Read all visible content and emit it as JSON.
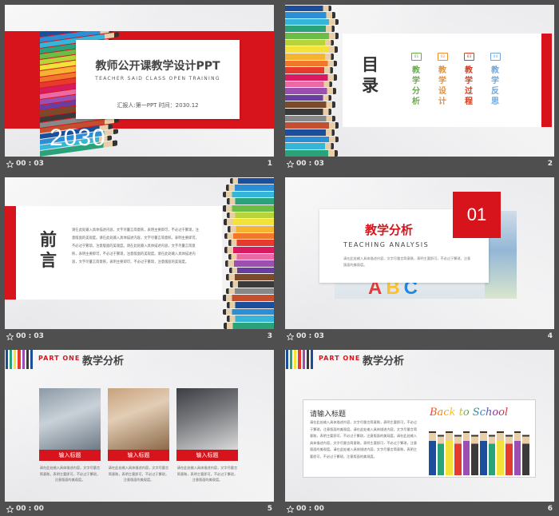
{
  "slides": [
    {
      "index": "1",
      "time": "00 : 03",
      "title": "教师公开课教学设计PPT",
      "subtitle": "TEACHER SAID CLASS OPEN TRAINING",
      "meta": "汇报人:第一PPT  时间：2030.12",
      "year": "2030"
    },
    {
      "index": "2",
      "time": "00 : 03",
      "heading": "目录",
      "items": [
        {
          "num": "01",
          "label": "教学分析",
          "color": "#6aa84f"
        },
        {
          "num": "02",
          "label": "教学设计",
          "color": "#e69138"
        },
        {
          "num": "03",
          "label": "教学过程",
          "color": "#cc4125"
        },
        {
          "num": "04",
          "label": "教学反思",
          "color": "#6fa8dc"
        }
      ]
    },
    {
      "index": "3",
      "time": "00 : 03",
      "heading": "前言",
      "body": "请在此处输入具体描述内容，文字尽量言简意赅，表明主要即可，不必过于繁琐，注意版面的美观度。请在此处输入具体描述内容，文字尽量言简意赅，表明主要即可，不必过于繁琐，注意版面的美观度。请在此处输入具体描述内容，文字尽量言简意赅，表明主要即可，不必过于繁琐，注意版面的美观度。请在此处输入具体描述内容，文字尽量言简意赅，表明主要即可，不必过于繁琐，注意版面的美观度。"
    },
    {
      "index": "4",
      "time": "00 : 03",
      "num": "01",
      "title": "教学分析",
      "subtitle": "TEACHING ANALYSIS",
      "body": "请在此处输入具体描述内容，文字尽量言简意赅，表明主要即可，不必过于繁琐，注意版面的美观度。",
      "abc": "ABC"
    },
    {
      "index": "5",
      "time": "00 : 00",
      "part": "PART ONE",
      "title": "教学分析",
      "cards": [
        {
          "label": "输入标题",
          "text": "请在此处输入具体描述内容，文字尽量言简意赅，表明主要即可，不必过于繁琐，注意版面的美观度。"
        },
        {
          "label": "输入标题",
          "text": "请在此处输入具体描述内容，文字尽量言简意赅，表明主要即可，不必过于繁琐，注意版面的美观度。"
        },
        {
          "label": "输入标题",
          "text": "请在此处输入具体描述内容，文字尽量言简意赅，表明主要即可，不必过于繁琐，注意版面的美观度。"
        }
      ]
    },
    {
      "index": "6",
      "time": "00 : 00",
      "part": "PART ONE",
      "title": "教学分析",
      "box_title": "请输入标题",
      "box_text": "请在此处输入具体描述内容，文字尽量言简意赅，表明主要即可，不必过于繁琐，注意版面的美观度。请在此处输入具体描述内容，文字尽量言简意赅，表明主要即可，不必过于繁琐，注意版面的美观度。请在此处输入具体描述内容，文字尽量言简意赅，表明主要即可，不必过于繁琐，注意版面的美观度。请在此处输入具体描述内容，文字尽量言简意赅，表明主要即可，不必过于繁琐，注意版面的美观度。",
      "banner": "Back to School"
    }
  ],
  "colors": {
    "accent": "#d7141b",
    "pencils": [
      "#1b4f9c",
      "#2c8fd6",
      "#35b6d8",
      "#2aa37a",
      "#6bbd45",
      "#b9d33a",
      "#f4e23a",
      "#f6b231",
      "#f1782b",
      "#e63a2e",
      "#d81b60",
      "#e96aa5",
      "#9b4fb0",
      "#6a3ea1",
      "#7a4a2b",
      "#3a3a3a",
      "#888888",
      "#c44f2e"
    ]
  }
}
